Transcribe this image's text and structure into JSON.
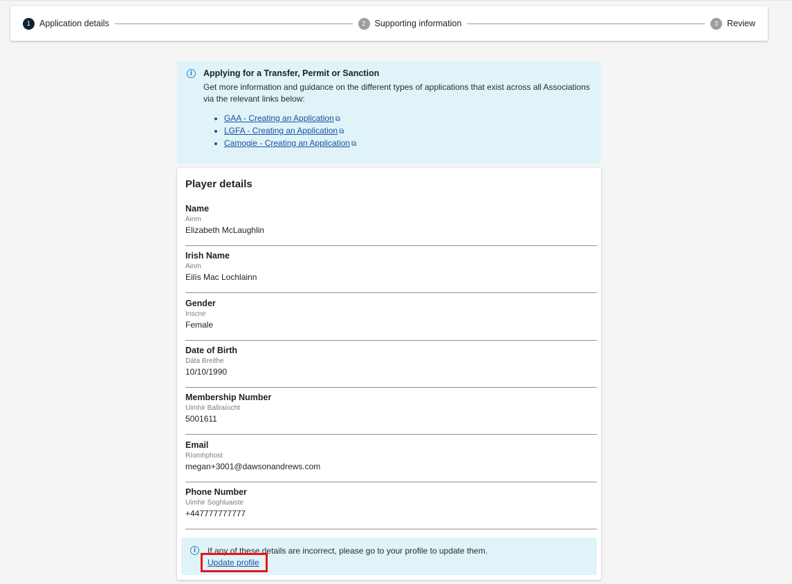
{
  "stepper": {
    "steps": [
      {
        "number": "1",
        "label": "Application details",
        "state": "active"
      },
      {
        "number": "2",
        "label": "Supporting information",
        "state": "inactive"
      },
      {
        "number": "3",
        "label": "Review",
        "state": "inactive"
      }
    ]
  },
  "info_alert": {
    "icon": "info-icon",
    "title": "Applying for a Transfer, Permit or Sanction",
    "text": "Get more information and guidance on the different types of applications that exist across all Associations via the relevant links below:",
    "links": [
      {
        "label": "GAA - Creating an Application",
        "icon": "external-link-icon"
      },
      {
        "label": "LGFA - Creating an Application",
        "icon": "external-link-icon"
      },
      {
        "label": "Camogie - Creating an Application",
        "icon": "external-link-icon"
      }
    ]
  },
  "player_details": {
    "title": "Player details",
    "fields": [
      {
        "label": "Name",
        "sub": "Ainm",
        "value": "Elizabeth McLaughlin"
      },
      {
        "label": "Irish Name",
        "sub": "Ainm",
        "value": "Eilís Mac Lochlainn"
      },
      {
        "label": "Gender",
        "sub": "Inscne",
        "value": "Female"
      },
      {
        "label": "Date of Birth",
        "sub": "Dáta Breithe",
        "value": "10/10/1990"
      },
      {
        "label": "Membership Number",
        "sub": "Uimhir Ballraíocht",
        "value": "5001611"
      },
      {
        "label": "Email",
        "sub": "Ríomhphost",
        "value": "megan+3001@dawsonandrews.com"
      },
      {
        "label": "Phone Number",
        "sub": "Uimhir Soghluaiste",
        "value": "+447777777777"
      }
    ],
    "notice": {
      "text": "If any of these details are incorrect, please go to your profile to update them.",
      "link_label": "Update profile"
    }
  },
  "colors": {
    "accent_link": "#1b4f9e",
    "alert_bg": "#dff3f9",
    "highlight": "#e8121a",
    "step_active": "#0f2233"
  }
}
